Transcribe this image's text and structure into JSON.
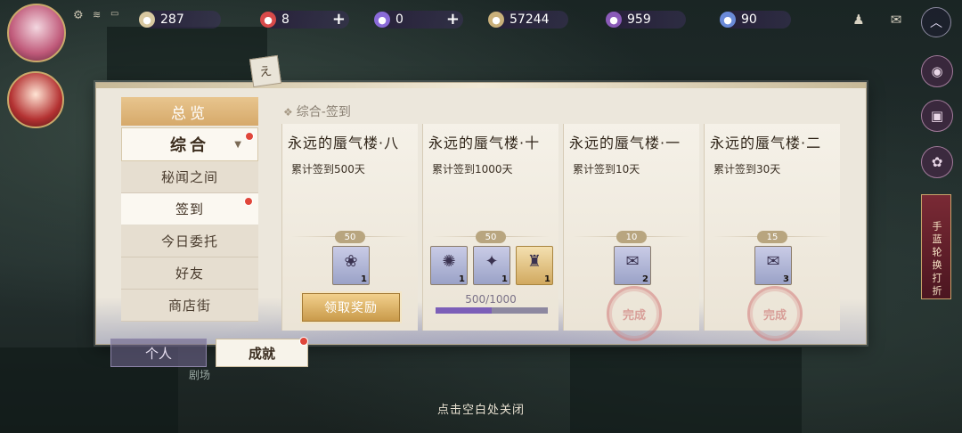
{
  "hud": {
    "resources": [
      {
        "name": "coin",
        "icon": "coin-icon",
        "value": "287",
        "plus": false,
        "color": "#d8c8a0"
      },
      {
        "name": "stamina",
        "icon": "heart-icon",
        "value": "8",
        "plus": true,
        "color": "#d84a4a"
      },
      {
        "name": "jade",
        "icon": "gem-icon",
        "value": "0",
        "plus": true,
        "color": "#8a6ad8"
      },
      {
        "name": "tickets",
        "icon": "ticket-icon",
        "value": "57244",
        "plus": false,
        "color": "#c9b07a"
      },
      {
        "name": "orb",
        "icon": "orb-icon",
        "value": "959",
        "plus": false,
        "color": "#8a5ab8"
      },
      {
        "name": "crystal",
        "icon": "crystal-icon",
        "value": "90",
        "plus": false,
        "color": "#6a8ad8"
      }
    ]
  },
  "panel": {
    "breadcrumb": "综合-签到",
    "nav": {
      "header": "总览",
      "category": "综合",
      "items": [
        {
          "label": "秘闻之间",
          "active": false,
          "dot": false
        },
        {
          "label": "签到",
          "active": true,
          "dot": true
        },
        {
          "label": "今日委托",
          "active": false,
          "dot": false
        },
        {
          "label": "好友",
          "active": false,
          "dot": false
        },
        {
          "label": "商店街",
          "active": false,
          "dot": false
        }
      ]
    },
    "cards": [
      {
        "title": "永远的蜃气楼·八",
        "subtitle": "累计签到500天",
        "points": "50",
        "items": [
          {
            "count": "1",
            "glyph": "❀",
            "gold": false
          }
        ],
        "claim_label": "领取奖励",
        "progress_text": "",
        "progress": 0,
        "completed": false
      },
      {
        "title": "永远的蜃气楼·十",
        "subtitle": "累计签到1000天",
        "points": "50",
        "items": [
          {
            "count": "1",
            "glyph": "✺",
            "gold": false
          },
          {
            "count": "1",
            "glyph": "✦",
            "gold": false
          },
          {
            "count": "1",
            "glyph": "♜",
            "gold": true
          }
        ],
        "claim_label": "",
        "progress_text": "500/1000",
        "progress": 0.5,
        "completed": false
      },
      {
        "title": "永远的蜃气楼·一",
        "subtitle": "累计签到10天",
        "points": "10",
        "items": [
          {
            "count": "2",
            "glyph": "✉",
            "gold": false
          }
        ],
        "claim_label": "",
        "progress_text": "",
        "progress": 1,
        "completed": true,
        "stamp": "完成"
      },
      {
        "title": "永远的蜃气楼·二",
        "subtitle": "累计签到30天",
        "points": "15",
        "items": [
          {
            "count": "3",
            "glyph": "✉",
            "gold": false
          }
        ],
        "claim_label": "",
        "progress_text": "",
        "progress": 1,
        "completed": true,
        "stamp": "完成"
      }
    ]
  },
  "bottom_tabs": {
    "personal": "个人",
    "achievement": "成就"
  },
  "theater_label": "剧场",
  "close_hint": "点击空白处关闭",
  "side_banner": "手 蓝 轮 换 打 折"
}
